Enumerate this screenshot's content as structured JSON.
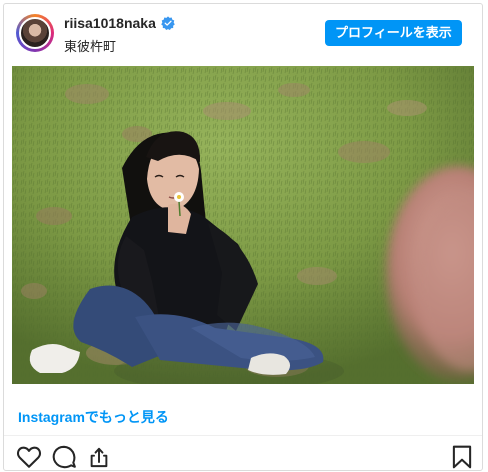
{
  "header": {
    "username": "riisa1018naka",
    "location": "東彼杵町",
    "profile_button_label": "プロフィールを表示",
    "verified_icon": "verified-badge-icon",
    "avatar_icon": "profile-avatar"
  },
  "post": {
    "photo_alt": "grass-field-photo",
    "more_link": "Instagramでもっと見る"
  },
  "actions": {
    "icons": [
      "heart-icon",
      "comment-icon",
      "share-icon",
      "bookmark-icon"
    ]
  },
  "colors": {
    "accent": "#0095f6",
    "text": "#262626",
    "border": "#dbdbdb",
    "verified": "#3897f0"
  }
}
